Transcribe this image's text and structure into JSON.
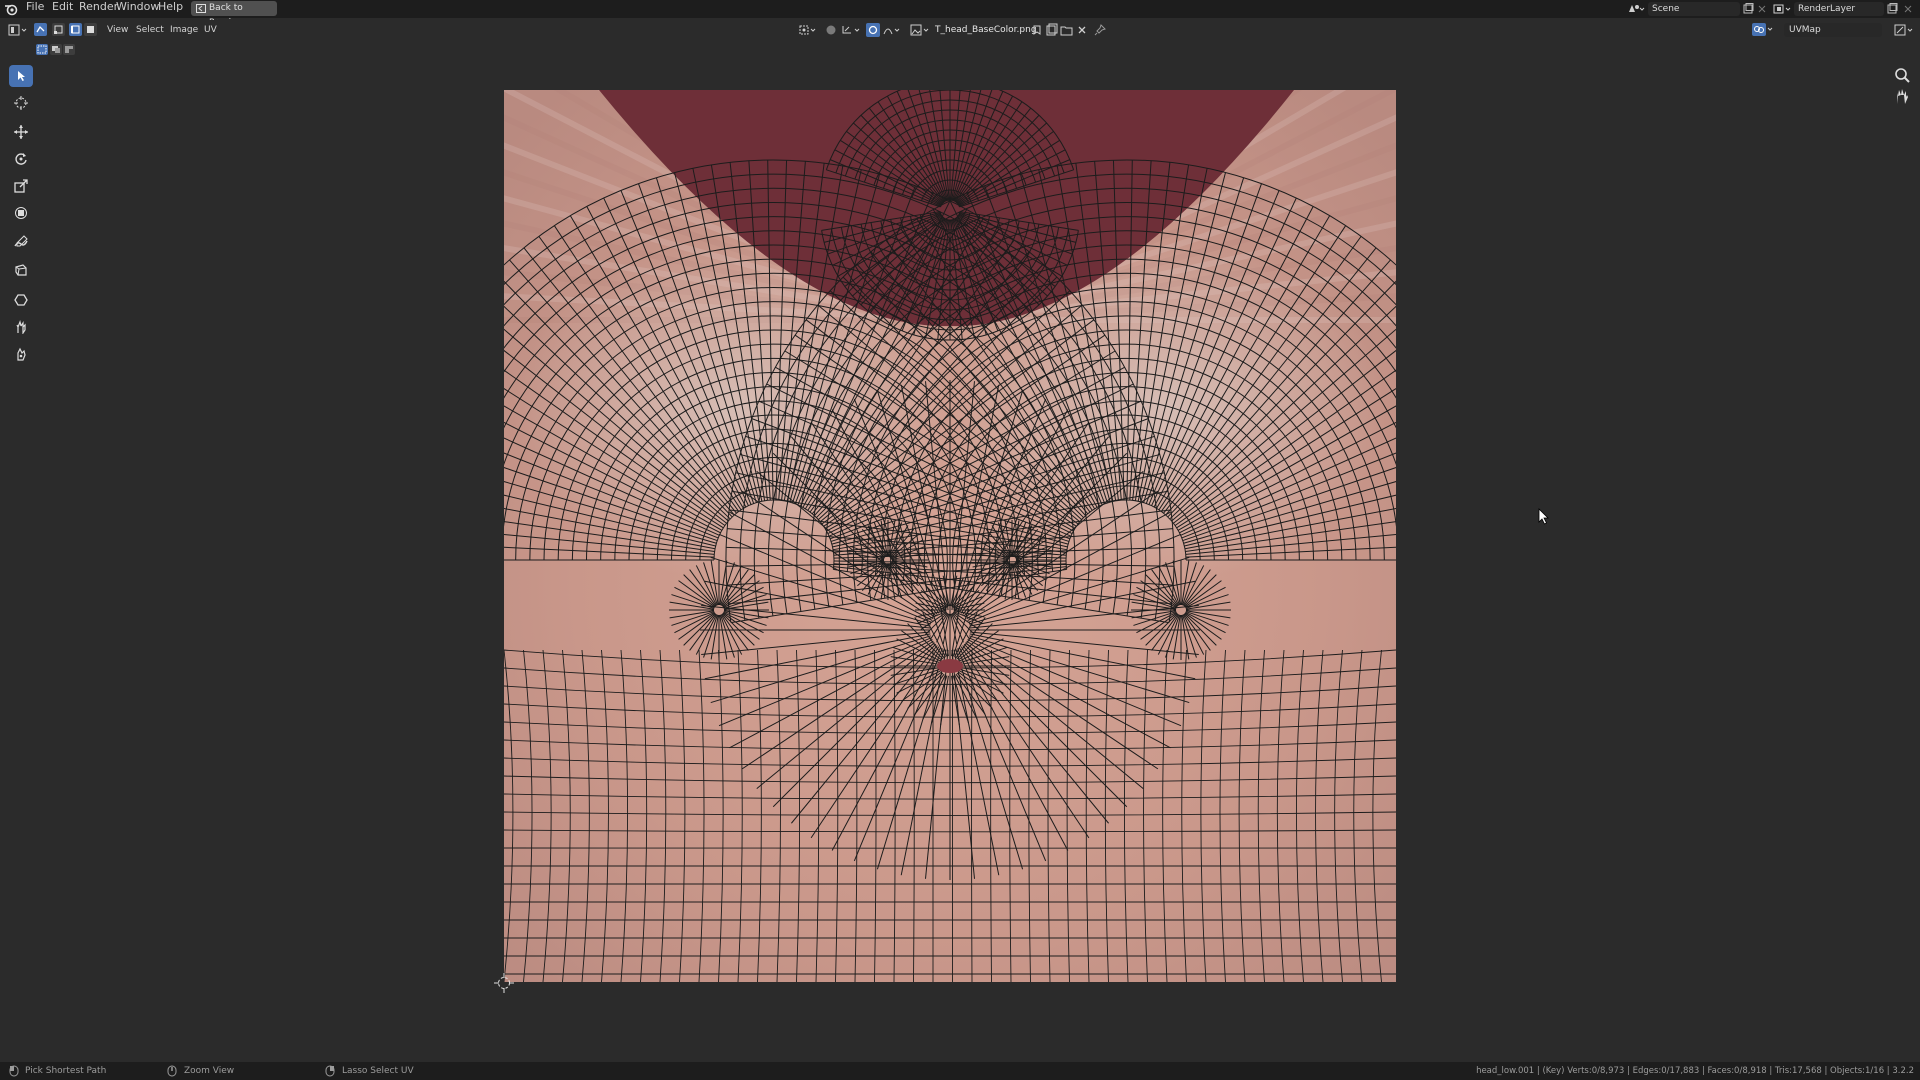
{
  "menubar": {
    "items": [
      "File",
      "Edit",
      "Render",
      "Window",
      "Help"
    ],
    "back_button": "Back to Previous",
    "scene_name": "Scene",
    "render_layer": "RenderLayer"
  },
  "header": {
    "menus": [
      "View",
      "Select",
      "Image",
      "UV"
    ],
    "image_name": "T_head_BaseColor.png",
    "uv_map": "UVMap"
  },
  "toolbar": {
    "tools": [
      "select-box",
      "cursor",
      "move",
      "rotate",
      "scale",
      "transform",
      "annotate",
      "annotate-polygon",
      "rip-region",
      "grab",
      "pinch"
    ],
    "active_tool": "select-box"
  },
  "statusbar": {
    "left_items": [
      "Pick Shortest Path",
      "Zoom View",
      "Lasso Select UV"
    ],
    "info": "head_low.001 | (Key) Verts:0/8,973 | Edges:0/17,883 | Faces:0/8,918 | Tris:17,568 | Objects:1/16 | 3.2.2"
  },
  "colors": {
    "accent": "#4772b3",
    "background": "#2b2b2b",
    "bar": "#1d1d1d",
    "skin": "#c8958a",
    "inner_mouth": "#6e2f38"
  }
}
